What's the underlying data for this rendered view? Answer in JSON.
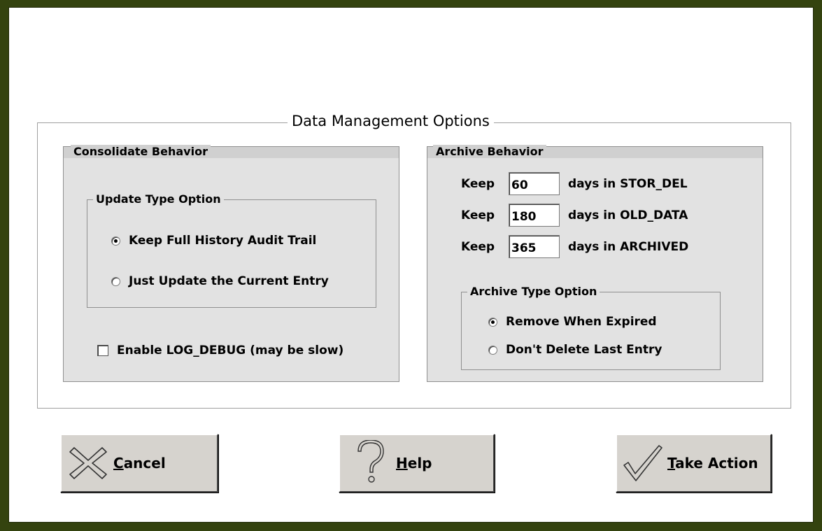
{
  "dialog": {
    "title": "Data Management Options"
  },
  "consolidate": {
    "title": "Consolidate Behavior",
    "update_type": {
      "title": "Update Type Option",
      "options": [
        {
          "label": "Keep Full History Audit Trail",
          "selected": true
        },
        {
          "label": "Just Update the Current Entry",
          "selected": false
        }
      ]
    },
    "log_debug": {
      "label": "Enable LOG_DEBUG (may be slow)",
      "checked": false
    }
  },
  "archive": {
    "title": "Archive Behavior",
    "keep_rows": [
      {
        "keep_label": "Keep",
        "value": "60",
        "suffix": "days in STOR_DEL"
      },
      {
        "keep_label": "Keep",
        "value": "180",
        "suffix": "days in OLD_DATA"
      },
      {
        "keep_label": "Keep",
        "value": "365",
        "suffix": "days in ARCHIVED"
      }
    ],
    "archive_type": {
      "title": "Archive Type Option",
      "options": [
        {
          "label": "Remove When Expired",
          "selected": true
        },
        {
          "label": "Don't Delete Last Entry",
          "selected": false
        }
      ]
    }
  },
  "buttons": {
    "cancel": {
      "mnemonic": "C",
      "rest": "ancel",
      "icon": "x-icon"
    },
    "help": {
      "mnemonic": "H",
      "rest": "elp",
      "icon": "question-mark-icon"
    },
    "take_action": {
      "mnemonic": "T",
      "rest": "ake Action",
      "icon": "checkmark-icon"
    }
  },
  "colors": {
    "frame": "#34430f",
    "panel": "#e2e2e2",
    "button_face": "#d6d3ce"
  }
}
